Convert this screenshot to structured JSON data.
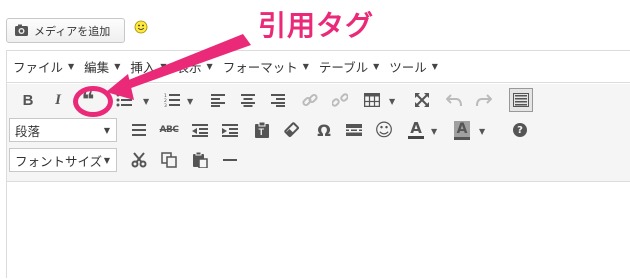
{
  "media_button": {
    "label": "メディアを追加",
    "icon": "camera-music-icon"
  },
  "emoji": {
    "icon": "smiley-icon"
  },
  "menubar": {
    "items": [
      {
        "label": "ファイル"
      },
      {
        "label": "編集"
      },
      {
        "label": "挿入"
      },
      {
        "label": "表示"
      },
      {
        "label": "フォーマット"
      },
      {
        "label": "テーブル"
      },
      {
        "label": "ツール"
      }
    ]
  },
  "toolbar": {
    "row1": {
      "bold": "B",
      "italic": "I",
      "blockquote": "❝",
      "bullist": "bullet-list-icon",
      "numlist": "numbered-list-icon",
      "align_left": "align-left-icon",
      "align_center": "align-center-icon",
      "align_right": "align-right-icon",
      "link": "link-icon",
      "unlink": "unlink-icon",
      "table": "table-icon",
      "fullscreen": "fullscreen-icon",
      "undo": "undo-icon",
      "redo": "redo-icon",
      "toolbar_toggle": "keyboard-icon"
    },
    "row2": {
      "format_select": "段落",
      "hr": "horizontal-rule-icon",
      "strikethrough": "ABC",
      "outdent": "outdent-icon",
      "indent": "indent-icon",
      "paste_text": "paste-text-icon",
      "clear_format": "eraser-icon",
      "special_char": "Ω",
      "page_break": "page-break-icon",
      "emoticons": "☺",
      "text_color": "A",
      "bg_color": "A",
      "help": "?"
    },
    "row3": {
      "font_size_select": "フォントサイズ",
      "cut": "scissors-icon",
      "copy": "copy-icon",
      "paste": "paste-icon",
      "hr2": "horizontal-line-icon"
    }
  },
  "annotation": {
    "label": "引用タグ",
    "color": "#ea2a79"
  }
}
